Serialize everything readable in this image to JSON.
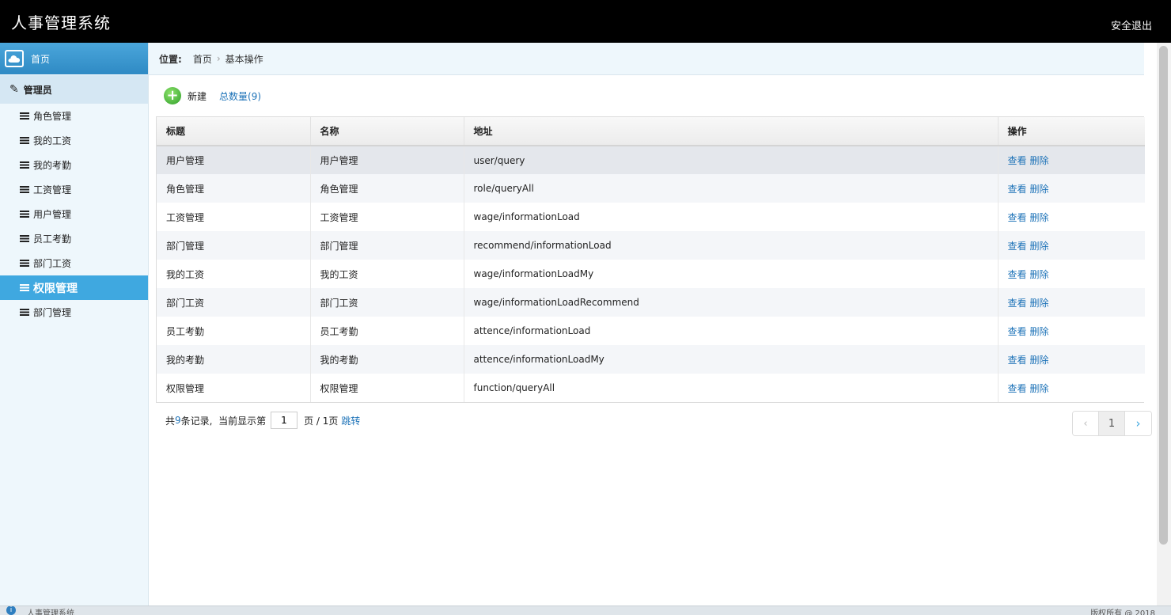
{
  "header": {
    "title": "人事管理系统",
    "logout": "安全退出"
  },
  "sidebar": {
    "home": "首页",
    "group": "管理员",
    "items": [
      {
        "label": "角色管理"
      },
      {
        "label": "我的工资"
      },
      {
        "label": "我的考勤"
      },
      {
        "label": "工资管理"
      },
      {
        "label": "用户管理"
      },
      {
        "label": "员工考勤"
      },
      {
        "label": "部门工资"
      },
      {
        "label": "权限管理"
      },
      {
        "label": "部门管理"
      }
    ],
    "active_index": 7
  },
  "breadcrumb": {
    "label": "位置:",
    "home": "首页",
    "separator": "›",
    "current": "基本操作"
  },
  "toolbar": {
    "add_label": "新建",
    "total_label": "总数量(9)"
  },
  "table": {
    "headers": [
      "标题",
      "名称",
      "地址",
      "操作"
    ],
    "rows": [
      {
        "title": "用户管理",
        "name": "用户管理",
        "url": "user/query"
      },
      {
        "title": "角色管理",
        "name": "角色管理",
        "url": "role/queryAll"
      },
      {
        "title": "工资管理",
        "name": "工资管理",
        "url": "wage/informationLoad"
      },
      {
        "title": "部门管理",
        "name": "部门管理",
        "url": "recommend/informationLoad"
      },
      {
        "title": "我的工资",
        "name": "我的工资",
        "url": "wage/informationLoadMy"
      },
      {
        "title": "部门工资",
        "name": "部门工资",
        "url": "wage/informationLoadRecommend"
      },
      {
        "title": "员工考勤",
        "name": "员工考勤",
        "url": "attence/informationLoad"
      },
      {
        "title": "我的考勤",
        "name": "我的考勤",
        "url": "attence/informationLoadMy"
      },
      {
        "title": "权限管理",
        "name": "权限管理",
        "url": "function/queryAll"
      }
    ],
    "view_label": "查看",
    "delete_label": "删除",
    "hover_row": 0
  },
  "pager": {
    "prefix": "共",
    "count": "9",
    "mid": "条记录,  当前显示第",
    "page_value": "1",
    "suffix": "页 / 1页",
    "jump": "跳转",
    "prev": "‹",
    "current": "1",
    "next": "›"
  },
  "statusbar": {
    "left": "人事管理系统",
    "right": "版权所有 @ 2018"
  }
}
